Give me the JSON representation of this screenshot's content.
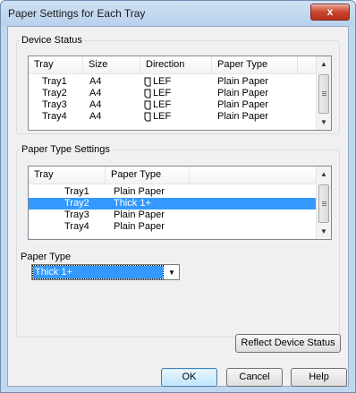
{
  "window": {
    "title": "Paper Settings for Each Tray",
    "close_label": "x"
  },
  "device_status": {
    "label": "Device Status",
    "columns": [
      "Tray",
      "Size",
      "Direction",
      "Paper Type"
    ],
    "rows": [
      {
        "tray": "Tray1",
        "size": "A4",
        "direction": "LEF",
        "paper_type": "Plain Paper"
      },
      {
        "tray": "Tray2",
        "size": "A4",
        "direction": "LEF",
        "paper_type": "Plain Paper"
      },
      {
        "tray": "Tray3",
        "size": "A4",
        "direction": "LEF",
        "paper_type": "Plain Paper"
      },
      {
        "tray": "Tray4",
        "size": "A4",
        "direction": "LEF",
        "paper_type": "Plain Paper"
      }
    ]
  },
  "paper_type_settings": {
    "label": "Paper Type Settings",
    "columns": [
      "Tray",
      "Paper Type"
    ],
    "selected_index": 1,
    "rows": [
      {
        "tray": "Tray1",
        "paper_type": "Plain Paper"
      },
      {
        "tray": "Tray2",
        "paper_type": "Thick 1+"
      },
      {
        "tray": "Tray3",
        "paper_type": "Plain Paper"
      },
      {
        "tray": "Tray4",
        "paper_type": "Plain Paper"
      }
    ]
  },
  "paper_type_field": {
    "label": "Paper Type",
    "value": "Thick 1+"
  },
  "buttons": {
    "reflect": "Reflect Device Status",
    "ok": "OK",
    "cancel": "Cancel",
    "help": "Help"
  },
  "colors": {
    "selection": "#3399ff",
    "title_bar": "#bfd7ef",
    "close_button": "#c9452e"
  },
  "icons": {
    "direction": "paper-lef-icon",
    "scroll_up": "arrow-up-icon",
    "scroll_down": "arrow-down-icon"
  }
}
